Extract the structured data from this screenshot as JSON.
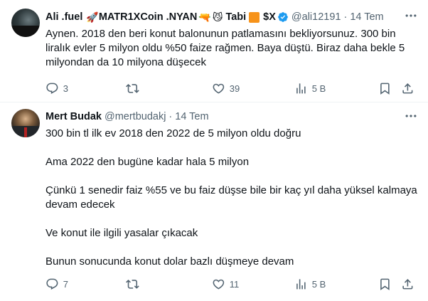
{
  "tweets": [
    {
      "name_text": "Ali .fuel",
      "name_tail": "MATR1XCoin .NYAN",
      "name_tail2": "Tabi",
      "name_tail3": "$X",
      "emoji_rocket": "🚀",
      "emoji_gun": "🔫",
      "emoji_face": "😼",
      "handle": "@ali12191",
      "dot": "·",
      "time": "14 Tem",
      "paragraphs": [
        "Aynen. 2018 den beri konut balonunun patlamasını bekliyorsunuz. 300 bin liralık evler 5 milyon oldu %50 faize rağmen. Baya düştü. Biraz daha bekle 5 milyondan da 10 milyona düşecek"
      ],
      "replies": "3",
      "reposts": "",
      "likes": "39",
      "views": "5 B"
    },
    {
      "name_text": "Mert Budak",
      "handle": "@mertbudakj",
      "dot": "·",
      "time": "14 Tem",
      "paragraphs": [
        "300 bin tl ilk ev 2018 den 2022 de 5 milyon oldu doğru",
        "",
        "Ama 2022 den bugüne kadar hala 5 milyon",
        "",
        "Çünkü 1 senedir  faiz %55 ve bu faiz düşse bile bir kaç yıl daha yüksel kalmaya devam edecek",
        "",
        "Ve konut ile ilgili yasalar çıkacak",
        "",
        "Bunun sonucunda konut dolar bazlı düşmeye devam"
      ],
      "replies": "7",
      "reposts": "",
      "likes": "11",
      "views": "5 B"
    }
  ],
  "colors": {
    "text": "#0f1419",
    "secondary": "#536471",
    "verified": "#1d9bf0",
    "divider": "#eff3f4",
    "orange_square": "#f7931a"
  },
  "icons": [
    "reply-icon",
    "repost-icon",
    "like-icon",
    "views-icon",
    "bookmark-icon",
    "share-icon",
    "more-icon",
    "verified-badge-icon"
  ]
}
